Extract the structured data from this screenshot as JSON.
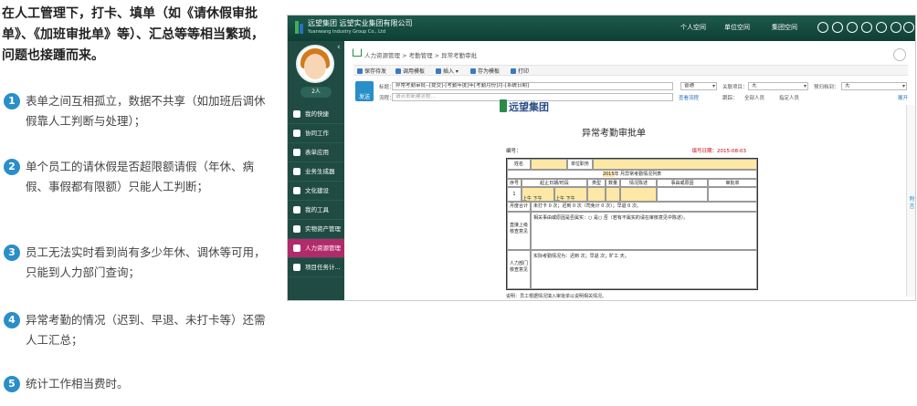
{
  "intro": {
    "headline": "在人工管理下，打卡、填单（如《请休假审批单》、《加班审批单》等）、汇总等等相当繁琐，问题也接踵而来。",
    "points": [
      {
        "num": "1",
        "text": "表单之间互相孤立，数据不共享（如加班后调休假靠人工判断与处理）；"
      },
      {
        "num": "2",
        "text": "单个员工的请休假是否超限额请假（年休、病假、事假都有限额）只能人工判断；"
      },
      {
        "num": "3",
        "text": "员工无法实时看到尚有多少年休、调休等可用，只能到人力部门查询；"
      },
      {
        "num": "4",
        "text": "异常考勤的情况（迟到、早退、未打卡等）还需人工汇总；"
      },
      {
        "num": "5",
        "text": "统计工作相当费时。"
      }
    ]
  },
  "app": {
    "brand_cn": "远望集团    远望实业集团有限公司",
    "brand_en": "Yuanwang Industry Group Co., Ltd",
    "nav": [
      "个人空间",
      "单位空间",
      "集团空间"
    ],
    "user_label": "2人",
    "sidebar": [
      "我的快捷",
      "协同工作",
      "表单应用",
      "业务生成器",
      "文化建设",
      "我的工具",
      "实物资产管理",
      "人力资源管理",
      "项目任务计..."
    ],
    "breadcrumb": "人力资源管理 > 考勤管理 > 异常考勤审批",
    "toolbar": [
      "保存待发",
      "调用模板",
      "插入 ▾",
      "存为模板",
      "打印"
    ],
    "send": "发送",
    "title_label": "标题：",
    "title_value": "异常考勤审批--[提交]-[考勤年度]年[考勤月份]月-[系统日期]",
    "priority": "普通",
    "related_label": "关联项目：",
    "related_value": "无",
    "deadline_label": "预归档到：",
    "deadline_value": "无",
    "flow_label": "流程：",
    "flow_placeholder": "请点击新建流程...",
    "view_flow": "查看流程",
    "trace_label": "跟踪：",
    "all_people": "全部人员",
    "specified": "指定人员",
    "expand": "展开",
    "right_tab": "附言"
  },
  "form": {
    "logo": "远望集团",
    "title": "异常考勤审批单",
    "no_label": "编号：",
    "date_label": "填写日期：2015-08-03",
    "name_label": "姓名",
    "dept_label": "单位职务",
    "year": "2015",
    "year_suffix": "年",
    "month_suffix": "月异常考勤情况列表",
    "headers": [
      "序号",
      "起止日期/时段",
      "类型",
      "数量",
      "情况陈述",
      "事由或原因",
      "审批单"
    ],
    "row_no": "1",
    "am": "上午",
    "pm": "下午",
    "month_summary_label": "月度合计",
    "month_summary": "未打卡  0  次；迟到  0  次（司免计  0  次）；早退  0  次。",
    "leader_label": "直接上级核查意见",
    "leader_text": "相关事由或原因是否属实：○ 是○ 否（若有不属实的请在审核意见中陈述）。",
    "hr_label": "人力部门核查意见",
    "hr_text": "实际考勤情况为：迟到    次；早退    次；旷工    天。",
    "note": "说明：员工根据情况填入审批单以说明相关情况。"
  }
}
